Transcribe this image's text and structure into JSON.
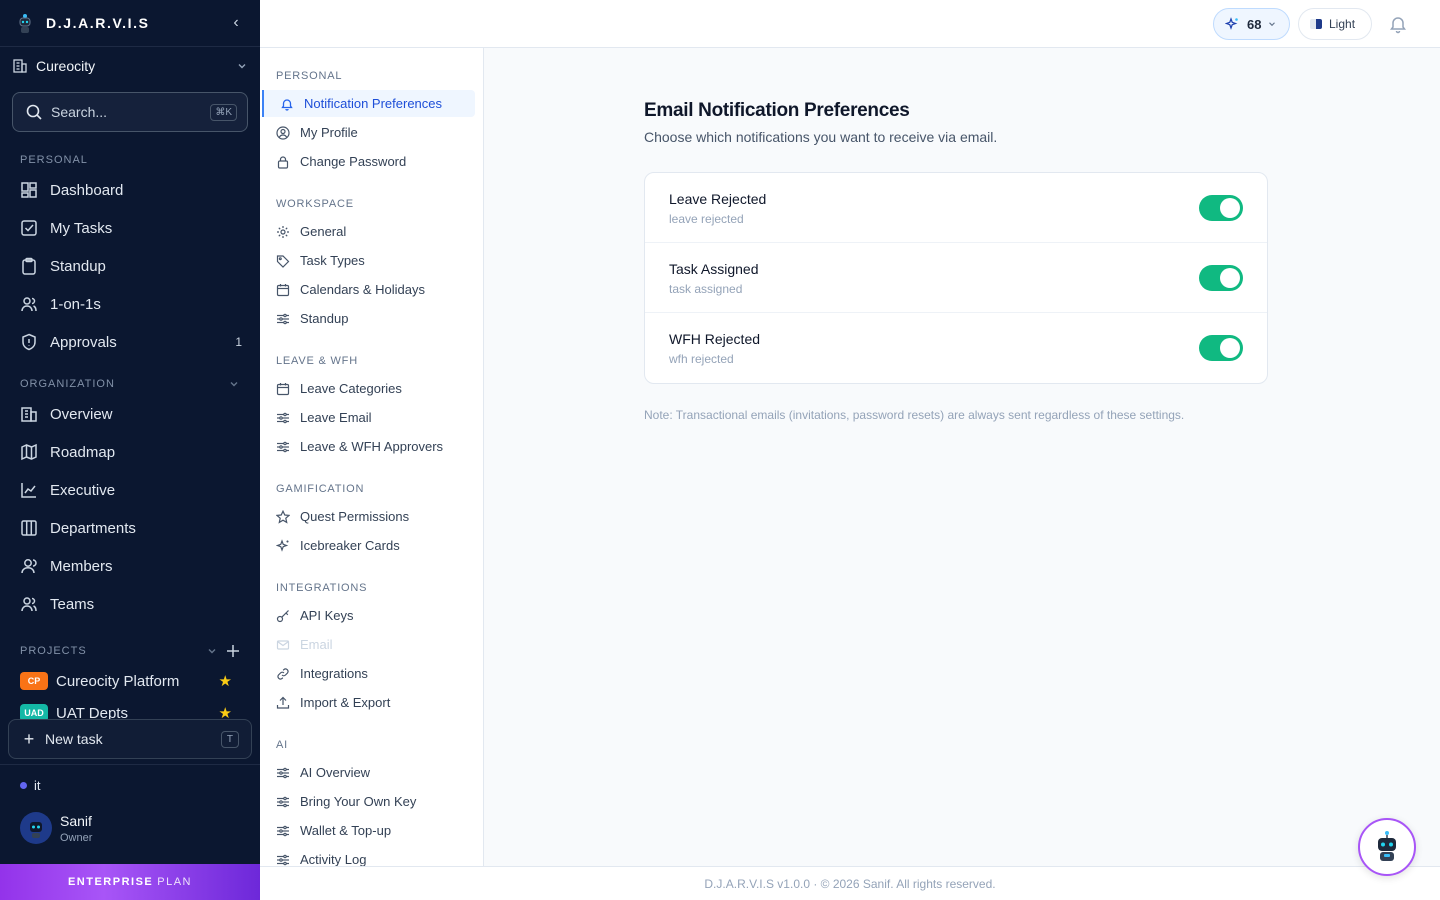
{
  "app": {
    "title": "D.J.A.R.V.I.S"
  },
  "workspace": {
    "name": "Cureocity"
  },
  "search": {
    "placeholder": "Search...",
    "shortcut": "⌘K"
  },
  "sidebar": {
    "personal_label": "PERSONAL",
    "personal": [
      {
        "label": "Dashboard"
      },
      {
        "label": "My Tasks"
      },
      {
        "label": "Standup"
      },
      {
        "label": "1-on-1s"
      },
      {
        "label": "Approvals",
        "badge": "1"
      }
    ],
    "organization_label": "ORGANIZATION",
    "organization": [
      {
        "label": "Overview"
      },
      {
        "label": "Roadmap"
      },
      {
        "label": "Executive"
      },
      {
        "label": "Departments"
      },
      {
        "label": "Members"
      },
      {
        "label": "Teams"
      }
    ],
    "projects_label": "PROJECTS",
    "projects": [
      {
        "badge": "CP",
        "label": "Cureocity Platform",
        "color": "#f97316"
      },
      {
        "badge": "UAD",
        "label": "UAT Depts",
        "color": "#14b8a6"
      }
    ],
    "new_task": {
      "label": "New task",
      "shortcut": "T"
    },
    "status": "it",
    "user": {
      "name": "Sanif",
      "role": "Owner"
    },
    "plan": {
      "bold": "ENTERPRISE",
      "thin": "PLAN"
    }
  },
  "topbar": {
    "xp": "68",
    "theme": "Light"
  },
  "settings_nav": {
    "personal_label": "PERSONAL",
    "personal": [
      "Notification Preferences",
      "My Profile",
      "Change Password"
    ],
    "workspace_label": "WORKSPACE",
    "workspace": [
      "General",
      "Task Types",
      "Calendars & Holidays",
      "Standup"
    ],
    "leave_label": "LEAVE & WFH",
    "leave": [
      "Leave Categories",
      "Leave Email",
      "Leave & WFH Approvers"
    ],
    "gamification_label": "GAMIFICATION",
    "gamification": [
      "Quest Permissions",
      "Icebreaker Cards"
    ],
    "integrations_label": "INTEGRATIONS",
    "integrations": [
      "API Keys",
      "Email",
      "Integrations",
      "Import & Export"
    ],
    "ai_label": "AI",
    "ai": [
      "AI Overview",
      "Bring Your Own Key",
      "Wallet & Top-up",
      "Activity Log"
    ]
  },
  "main": {
    "title": "Email Notification Preferences",
    "subtitle": "Choose which notifications you want to receive via email.",
    "prefs": [
      {
        "title": "Leave Rejected",
        "desc": "leave rejected",
        "enabled": true
      },
      {
        "title": "Task Assigned",
        "desc": "task assigned",
        "enabled": true
      },
      {
        "title": "WFH Rejected",
        "desc": "wfh rejected",
        "enabled": true
      }
    ],
    "note": "Note: Transactional emails (invitations, password resets) are always sent regardless of these settings."
  },
  "footer": {
    "text": "D.J.A.R.V.I.S v1.0.0 · © 2026 Sanif. All rights reserved."
  },
  "colors": {
    "sidebar_bg": "#0b1730",
    "accent": "#3b82f6",
    "toggle_on": "#10b981",
    "plan_gradient": "#9333ea"
  }
}
